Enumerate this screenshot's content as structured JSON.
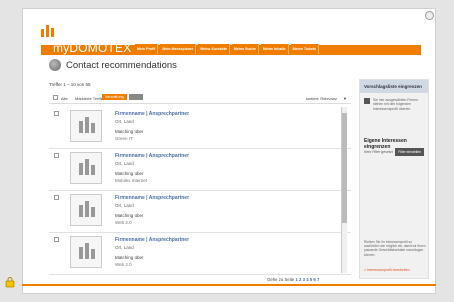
{
  "header": {
    "logo_text": "myDOMOTEX",
    "nav": [
      "Mein Profil",
      "Mein Messeplaner",
      "Meine Kontakte",
      "Meine Suche",
      "Meine Inhalte",
      "Meine Tickets"
    ]
  },
  "main": {
    "title": "Contact recommendations",
    "results_count": "Treffer 1 – 10 von 65",
    "toolbar": {
      "select_all": "Alle",
      "mark_label": "Markierte Treffer",
      "action_button": "Verwaltung",
      "sort_label": "sortiert: Relevanz",
      "sort_arrow": "▼"
    },
    "items": [
      {
        "name": "Firmenname | Ansprechpartner",
        "location": "Ort, Land",
        "match_label": "Matching über",
        "topic": "Green IT"
      },
      {
        "name": "Firmenname | Ansprechpartner",
        "location": "Ort, Land",
        "match_label": "Matching über",
        "topic": "Mobiles Internet"
      },
      {
        "name": "Firmenname | Ansprechpartner",
        "location": "Ort, Land",
        "match_label": "Matching über",
        "topic": "Web 2.0"
      },
      {
        "name": "Firmenname | Ansprechpartner",
        "location": "Ort, Land",
        "match_label": "Matching über",
        "topic": "Web 2.0"
      }
    ],
    "pagination": {
      "label": "Gehe zu Seite",
      "pages": "1 2 3 4 5 6 7"
    }
  },
  "sidebar": {
    "title": "Vorschlagsliste eingrenzen",
    "checkbox_text": "Sie hier ausgewählten Firmen stehen mit den folgenden Interessensprofil überein.",
    "own_title": "Eigene Interessen eingrenzen",
    "no_filter": "Kein Filter gesetzt",
    "filter_button": "Filter einstellen",
    "note": "Richten Sie Ihr Interessenprofil so ausführlich wie möglich ein, damit wir Ihnen passende Geschäftskontakte vorschlagen können.",
    "edit_link": "> Interessenprofil bearbeiten"
  },
  "colors": {
    "brand": "#f07d00",
    "link": "#4a6fa5"
  }
}
